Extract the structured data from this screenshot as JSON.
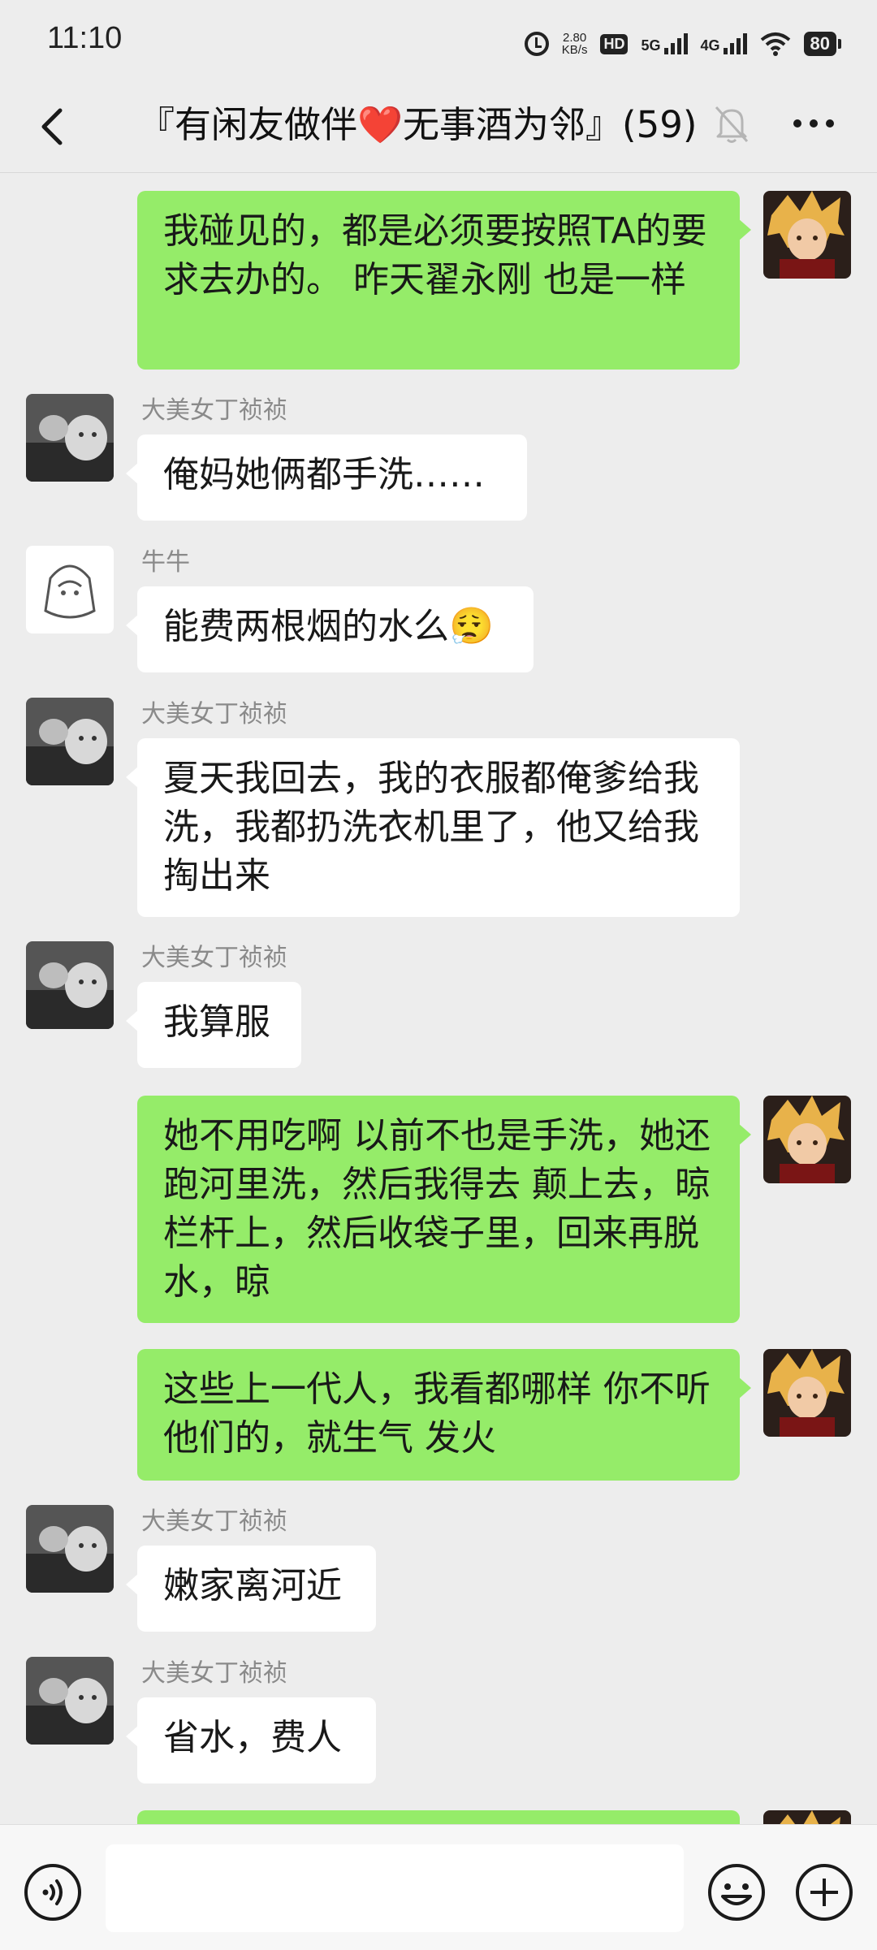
{
  "status": {
    "time": "11:10",
    "net_speed": "2.80",
    "net_unit": "KB/s",
    "hd": "HD",
    "sim1": "5G",
    "sim2": "4G",
    "battery": "80"
  },
  "nav": {
    "title": "『有闲友做伴❤️无事酒为邻』(59)"
  },
  "messages": [
    {
      "side": "right",
      "sender": "",
      "text": "我碰见的，都是必须要按照TA的要求去办的。 昨天翟永刚 也是一样"
    },
    {
      "side": "left",
      "sender": "大美女丁祯祯",
      "text": "俺妈她俩都手洗……"
    },
    {
      "side": "left",
      "sender": "牛牛",
      "text": "能费两根烟的水么😮‍💨"
    },
    {
      "side": "left",
      "sender": "大美女丁祯祯",
      "text": "夏天我回去，我的衣服都俺爹给我洗，我都扔洗衣机里了，他又给我掏出来"
    },
    {
      "side": "left",
      "sender": "大美女丁祯祯",
      "text": "我算服"
    },
    {
      "side": "right",
      "sender": "",
      "text": "她不用吃啊  以前不也是手洗，她还跑河里洗，然后我得去 颠上去，晾栏杆上，然后收袋子里，回来再脱水，晾"
    },
    {
      "side": "right",
      "sender": "",
      "text": "这些上一代人，我看都哪样  你不听他们的，就生气 发火"
    },
    {
      "side": "left",
      "sender": "大美女丁祯祯",
      "text": "嫩家离河近"
    },
    {
      "side": "left",
      "sender": "大美女丁祯祯",
      "text": "省水，费人"
    }
  ],
  "input": {
    "placeholder": ""
  },
  "icons": {
    "back": "chevron-left-icon",
    "mute": "bell-off-icon",
    "more": "more-dots-icon",
    "voice": "voice-icon",
    "emoji": "emoji-icon",
    "plus": "plus-icon"
  },
  "colors": {
    "background": "#ededed",
    "sent_bubble": "#95ec69",
    "received_bubble": "#ffffff",
    "sender_name": "#8a8a8a"
  }
}
